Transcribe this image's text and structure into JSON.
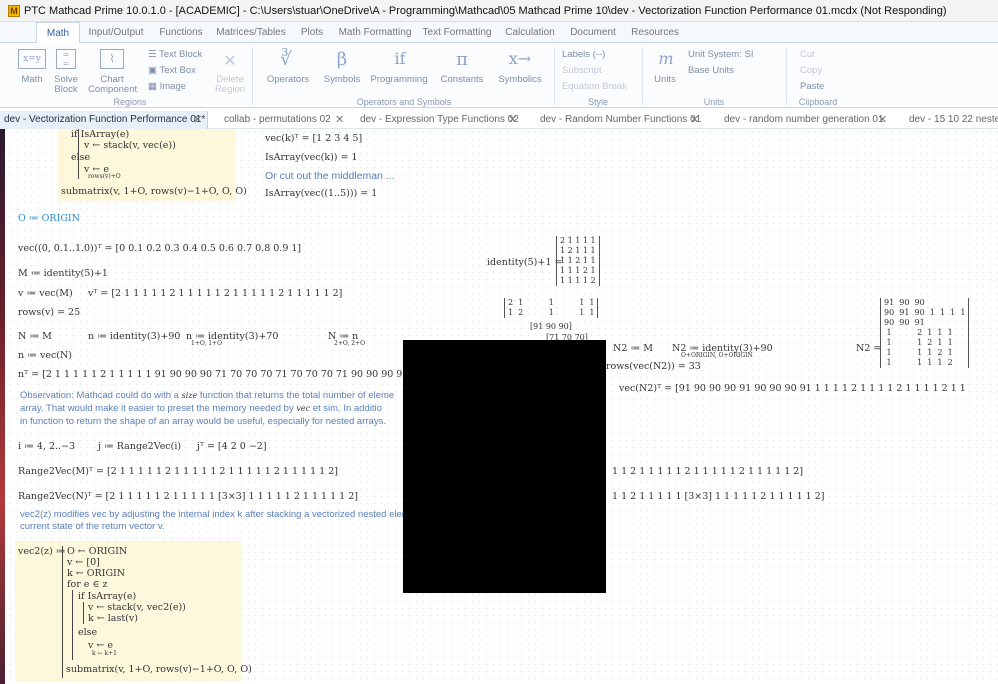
{
  "title": "PTC Mathcad Prime 10.0.1.0 - [ACADEMIC] - C:\\Users\\stuar\\OneDrive\\A - Programming\\Mathcad\\05 Mathcad Prime 10\\dev - Vectorization Function Performance 01.mcdx (Not Responding)",
  "ribbon_tabs": [
    "Math",
    "Input/Output",
    "Functions",
    "Matrices/Tables",
    "Plots",
    "Math Formatting",
    "Text Formatting",
    "Calculation",
    "Document",
    "Resources"
  ],
  "ribbon": {
    "math": "Math",
    "solve_block": "Solve\nBlock",
    "chart_component": "Chart\nComponent",
    "text_block": "Text Block",
    "text_box": "Text Box",
    "image": "Image",
    "delete_region": "Delete\nRegion",
    "operators": "Operators",
    "symbols": "Symbols",
    "programming": "Programming",
    "constants": "Constants",
    "symbolics": "Symbolics",
    "labels": "Labels  (--)",
    "subscript": "Subscript",
    "equation_break": "Equation Break",
    "units": "Units",
    "unit_system": "Unit System:  SI",
    "base_units": "Base Units",
    "cut": "Cut",
    "copy": "Copy",
    "paste": "Paste",
    "groups": [
      "Regions",
      "Operators and Symbols",
      "Style",
      "Units",
      "Clipboard"
    ]
  },
  "doc_tabs": [
    "dev - Vectorization Function Performance 01*",
    "collab - permutations 02",
    "dev - Expression Type Functions 02",
    "dev - Random Number Functions 01",
    "dev - random number generation 01",
    "dev - 15 10 22 nested a"
  ],
  "ws": {
    "p1_l1": "if IsArray(e)",
    "p1_l2": "v ← stack(v, vec(e))",
    "p1_l3": "else",
    "p1_l4": "v       ← e",
    "p1_l4s": "rows(v)+O",
    "p1_l5": "submatrix(v, 1+O, rows(v)−1+O, O, O)",
    "veck": "vec(k)ᵀ = [1  2  3  4  5]",
    "isarr1": "IsArray(vec(k)) = 1",
    "note1": "Or cut out the middleman ...",
    "isarr2": "IsArray(vec((1..5))) = 1",
    "origin": "O ≔ ORIGIN",
    "vec01": "vec((0, 0.1..1.0))ᵀ = [0  0.1  0.2  0.3  0.4  0.5  0.6  0.7  0.8  0.9  1]",
    "identity_eq": "identity(5)+1 =",
    "identity_m": "2 1 1 1 1\n1 2 1 1 1\n1 1 2 1 1\n1 1 1 2 1\n1 1 1 1 2",
    "mdef": "M ≔ identity(5)+1",
    "vdef": "v ≔ vec(M)",
    "vT": "vᵀ = [2  1  1  1  1  1  2  1  1  1  1  1  2  1  1  1  1  1  2  1  1  1  1  1  2]",
    "rows": "rows(v) = 25",
    "ndef": "N ≔ M",
    "n1": "n ≔ identity(3)+90",
    "n2": "n         ≔ identity(3)+70",
    "n2s": "1+O, 1+O",
    "n3": "N          ≔ n",
    "n3s": "2+O, 2+O",
    "nvec": "n ≔ vec(N)",
    "nT": "nᵀ = [2  1  1  1  1  1  2  1  1  1  1  1  91  90  90  90  71  70  70  70  71  70  70  70  71  90  90  90  9",
    "obs1": "Observation: Mathcad could do with a",
    "obs1b": "size",
    "obs1c": "function that returns the total number of eleme",
    "obs2": "array.  That would make it easier to preset the memory needed by",
    "obs2b": "vec",
    "obs2c": "et sim.  In additio",
    "obs3": "in function to return the shape of an array would be useful, especially for nested arrays.",
    "idef": "i ≔ 4, 2..−3",
    "jdef": "j ≔ Range2Vec(i)",
    "jT": "jᵀ = [4  2  0  −2]",
    "r2vM": "Range2Vec(M)ᵀ = [2  1  1  1  1  1  2  1  1  1  1  1  2  1  1  1  1  1  2  1  1  1  1  1  2]",
    "r2vN": "Range2Vec(N)ᵀ = [2  1  1  1  1  1  2  1  1  1  1  1  [3×3]  1  1  1  1  1  2  1  1  1  1  1  2]",
    "rightM": "1  1  2  1  1  1  1  1  2  1  1  1  1  1  2  1  1  1  1  1  2]",
    "rightN": "1  1  2  1  1  1  1  1  [3×3]  1  1  1  1  1  2  1  1  1  1  1  2]",
    "vec2note": "vec2(z) modifies  vec by adjusting the internal index  k  after stacking a vectorized nested element",
    "vec2note2": "current state of the return vector  v.",
    "p2_def": "vec2(z) ≔",
    "p2_l1": "O ← ORIGIN",
    "p2_l2": "v ← [0]",
    "p2_l3": "k ← ORIGIN",
    "p2_l4": "for e ∈ z",
    "p2_l5": "if IsArray(e)",
    "p2_l6": "v ← stack(v, vec2(e))",
    "p2_l7": "k ← last(v)",
    "p2_l8": "else",
    "p2_l9": "v       ← e",
    "p2_l9s": "k ← k+1",
    "p2_l10": "submatrix(v, 1+O, rows(v)−1+O, O, O)",
    "nmat_top": "2  1          1          1  1\n1  2          1          1  1",
    "n2def": "N2 ≔ M",
    "n2b": "N2                ≔ identity(3)+90",
    "n2bs": "O+ORIGIN, O+ORIGIN",
    "n2eq": "N2 =",
    "n2m": "91  90  90\n90  91  90  1  1  1  1\n90  90  91\n 1          2  1  1  1\n 1          1  2  1  1\n 1          1  1  2  1\n 1          1  1  1  2",
    "rowsN2": "rows(vec(N2)) = 33",
    "vecN2": "vec(N2)ᵀ = [91  90  90  90  91  90  90  90  91  1  1  1  1  2  1  1  1  1  2  1  1  1  1  2  1  1"
  }
}
